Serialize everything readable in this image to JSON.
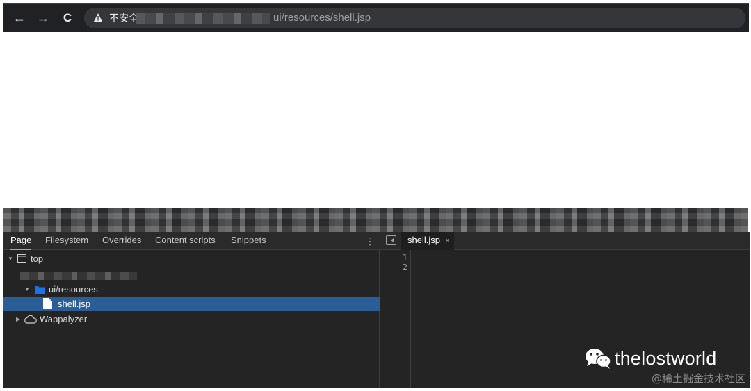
{
  "browser": {
    "back_icon": "←",
    "forward_icon": "→",
    "reload_icon": "C",
    "warning_icon": "warning-triangle-icon",
    "not_secure_label": "不安全",
    "url_path": "ui/resources/shell.jsp"
  },
  "devtools": {
    "tabs": [
      "Page",
      "Filesystem",
      "Overrides",
      "Content scripts",
      "Snippets"
    ],
    "tree": {
      "top_label": "top",
      "folder_label": "ui/resources",
      "file_label": "shell.jsp",
      "extension_label": "Wappalyzer"
    },
    "editor": {
      "open_tab_label": "shell.jsp",
      "close_label": "×",
      "line_numbers": [
        "1",
        "2"
      ]
    }
  },
  "watermark": {
    "brand": "thelostworld",
    "site": "@稀土掘金技术社区"
  },
  "colors": {
    "devtools_bg": "#242424",
    "selection": "#2b5d96",
    "browser_bar": "#202124",
    "omnibox": "#35363a"
  }
}
